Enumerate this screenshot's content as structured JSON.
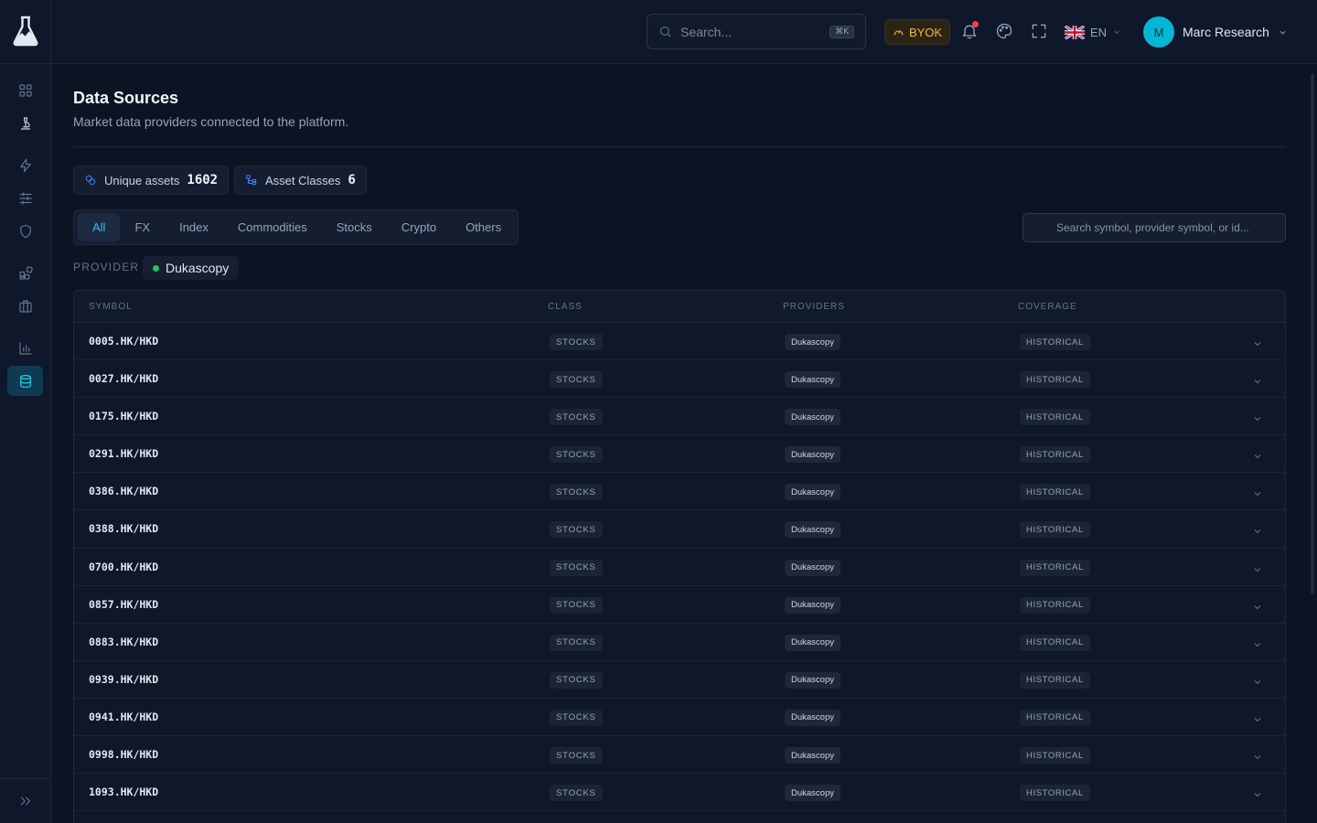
{
  "header": {
    "search_placeholder": "Search...",
    "search_shortcut": "⌘K",
    "byok_label": "BYOK",
    "language": "EN",
    "user": {
      "initial": "M",
      "name": "Marc Research"
    }
  },
  "page": {
    "title": "Data Sources",
    "subtitle": "Market data providers connected to the platform."
  },
  "stats": {
    "unique_assets_label": "Unique assets",
    "unique_assets_value": "1602",
    "asset_classes_label": "Asset Classes",
    "asset_classes_value": "6"
  },
  "tabs": [
    "All",
    "FX",
    "Index",
    "Commodities",
    "Stocks",
    "Crypto",
    "Others"
  ],
  "active_tab": "All",
  "table_search_placeholder": "Search symbol, provider symbol, or id...",
  "provider_filter": {
    "label": "PROVIDER",
    "value": "Dukascopy",
    "status_color": "#22c55e"
  },
  "table": {
    "headers": [
      "SYMBOL",
      "CLASS",
      "PROVIDERS",
      "COVERAGE"
    ],
    "rows": [
      {
        "symbol": "0005.HK/HKD",
        "class": "STOCKS",
        "provider": "Dukascopy",
        "coverage": "HISTORICAL"
      },
      {
        "symbol": "0027.HK/HKD",
        "class": "STOCKS",
        "provider": "Dukascopy",
        "coverage": "HISTORICAL"
      },
      {
        "symbol": "0175.HK/HKD",
        "class": "STOCKS",
        "provider": "Dukascopy",
        "coverage": "HISTORICAL"
      },
      {
        "symbol": "0291.HK/HKD",
        "class": "STOCKS",
        "provider": "Dukascopy",
        "coverage": "HISTORICAL"
      },
      {
        "symbol": "0386.HK/HKD",
        "class": "STOCKS",
        "provider": "Dukascopy",
        "coverage": "HISTORICAL"
      },
      {
        "symbol": "0388.HK/HKD",
        "class": "STOCKS",
        "provider": "Dukascopy",
        "coverage": "HISTORICAL"
      },
      {
        "symbol": "0700.HK/HKD",
        "class": "STOCKS",
        "provider": "Dukascopy",
        "coverage": "HISTORICAL"
      },
      {
        "symbol": "0857.HK/HKD",
        "class": "STOCKS",
        "provider": "Dukascopy",
        "coverage": "HISTORICAL"
      },
      {
        "symbol": "0883.HK/HKD",
        "class": "STOCKS",
        "provider": "Dukascopy",
        "coverage": "HISTORICAL"
      },
      {
        "symbol": "0939.HK/HKD",
        "class": "STOCKS",
        "provider": "Dukascopy",
        "coverage": "HISTORICAL"
      },
      {
        "symbol": "0941.HK/HKD",
        "class": "STOCKS",
        "provider": "Dukascopy",
        "coverage": "HISTORICAL"
      },
      {
        "symbol": "0998.HK/HKD",
        "class": "STOCKS",
        "provider": "Dukascopy",
        "coverage": "HISTORICAL"
      },
      {
        "symbol": "1093.HK/HKD",
        "class": "STOCKS",
        "provider": "Dukascopy",
        "coverage": "HISTORICAL"
      }
    ]
  },
  "colors": {
    "accent": "#22d3ee",
    "byok": "#f5b83d",
    "notification": "#ef4444",
    "avatar": "#06b6d4"
  },
  "icons": {
    "sidebar": [
      "dashboard-icon",
      "lab-icon",
      "lightning-icon",
      "sliders-icon",
      "shield-icon",
      "blocks-icon",
      "briefcase-icon",
      "bar-chart-icon",
      "database-icon",
      "expand-sidebar-icon"
    ],
    "header": [
      "search-icon",
      "gauge-icon",
      "bell-icon",
      "palette-icon",
      "fullscreen-icon",
      "uk-flag-icon",
      "chevron-down-icon"
    ]
  }
}
